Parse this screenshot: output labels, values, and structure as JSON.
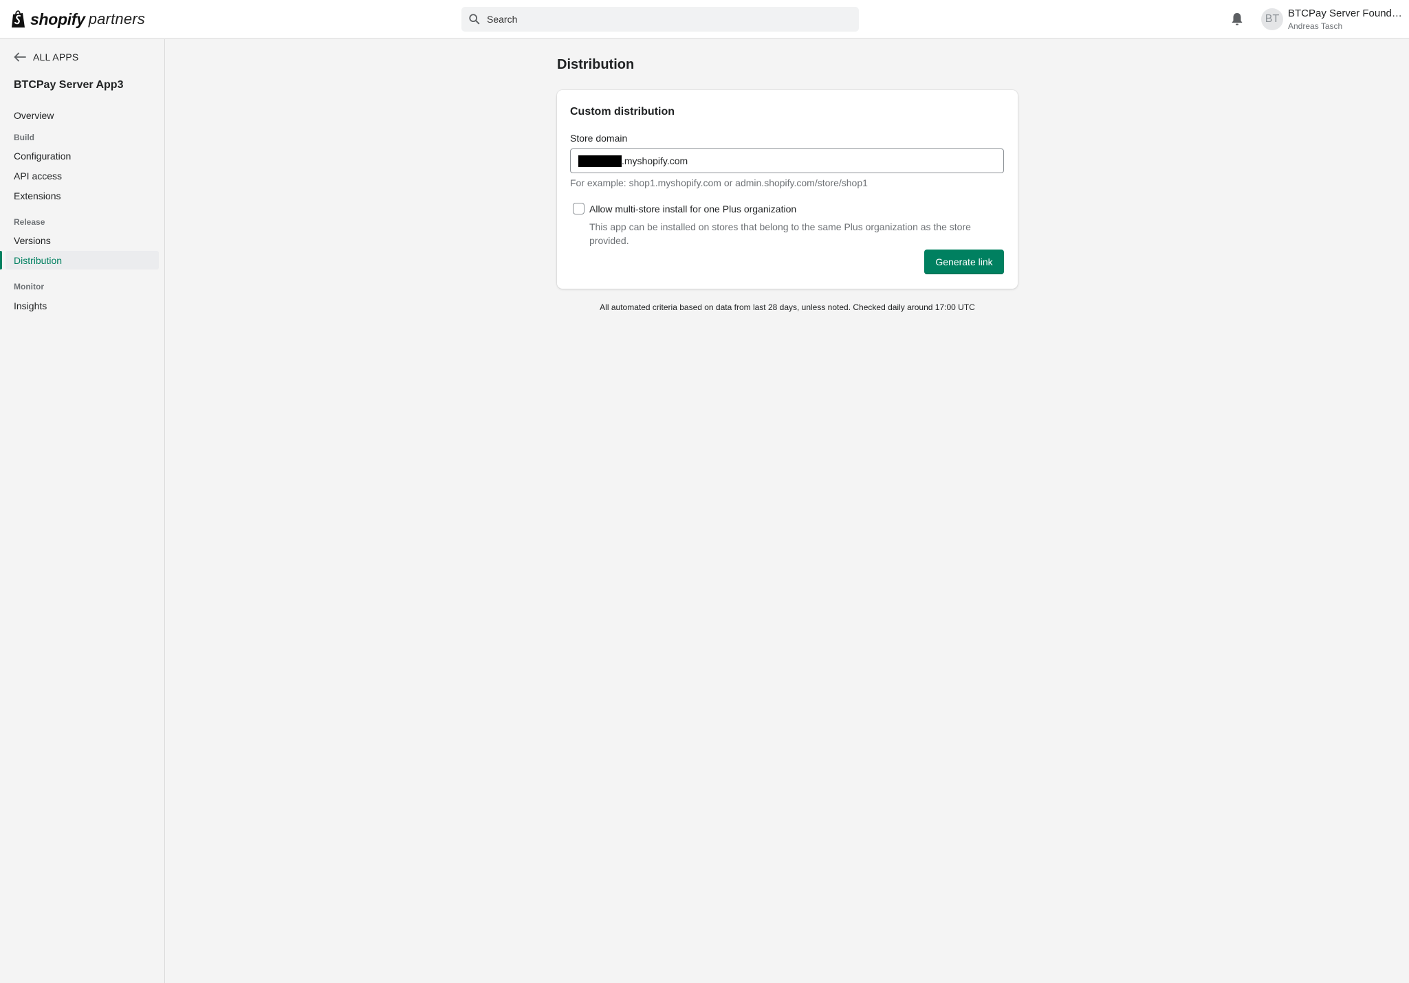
{
  "header": {
    "logo_brand": "shopify",
    "logo_suffix": "partners",
    "search_placeholder": "Search",
    "notifications_icon": "bell-icon",
    "avatar_initials": "BT",
    "account_name": "BTCPay Server Found…",
    "account_user": "Andreas Tasch"
  },
  "sidebar": {
    "back_label": "ALL APPS",
    "app_title": "BTCPay Server App3",
    "overview": "Overview",
    "sections": [
      {
        "title": "Build",
        "items": [
          "Configuration",
          "API access",
          "Extensions"
        ]
      },
      {
        "title": "Release",
        "items": [
          "Versions",
          "Distribution"
        ]
      },
      {
        "title": "Monitor",
        "items": [
          "Insights"
        ]
      }
    ],
    "active_item": "Distribution",
    "accent_color": "#008060"
  },
  "main": {
    "page_title": "Distribution",
    "card": {
      "title": "Custom distribution",
      "store_domain_label": "Store domain",
      "store_domain_value_suffix": ".myshopify.com",
      "store_domain_help": "For example: shop1.myshopify.com or admin.shopify.com/store/shop1",
      "multistore_label": "Allow multi-store install for one Plus organization",
      "multistore_checked": false,
      "multistore_help": "This app can be installed on stores that belong to the same Plus organization as the store provided.",
      "generate_button": "Generate link",
      "button_color": "#008060"
    },
    "footnote": "All automated criteria based on data from last 28 days, unless noted. Checked daily around 17:00 UTC"
  }
}
